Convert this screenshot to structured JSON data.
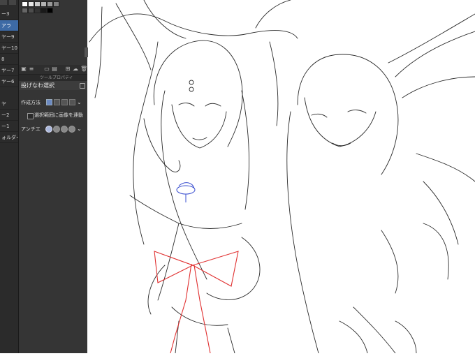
{
  "layers": {
    "items": [
      {
        "label": "ー3",
        "active": false
      },
      {
        "label": "アラ",
        "active": true
      },
      {
        "label": "ヤー9",
        "active": false
      },
      {
        "label": "ヤー10",
        "active": false
      },
      {
        "label": "8",
        "active": false
      },
      {
        "label": "ヤー7",
        "active": false
      },
      {
        "label": "ヤー6",
        "active": false
      },
      {
        "label": "ヤ",
        "active": false
      },
      {
        "label": "ー2",
        "active": false
      },
      {
        "label": "ー1",
        "active": false
      },
      {
        "label": "ォルダー",
        "active": false
      }
    ]
  },
  "tool_property": {
    "header": "ツールプロパティ",
    "tool_name": "投げなわ選択",
    "mode_label": "作成方法",
    "link_label": "選択範囲に画像を連動",
    "antialias_label": "アンチエ"
  },
  "palette": {
    "colors": [
      "#ffffff",
      "#e6e6e6",
      "#cccccc",
      "#b3b3b3",
      "#999999",
      "#808080",
      "#666666",
      "#4d4d4d",
      "#333333",
      "#1a1a1a",
      "#000000"
    ]
  },
  "sketch": {
    "line_color": "#2b2b2b",
    "ribbon_color": "#e03030",
    "emblem_color": "#3a4fd0"
  }
}
